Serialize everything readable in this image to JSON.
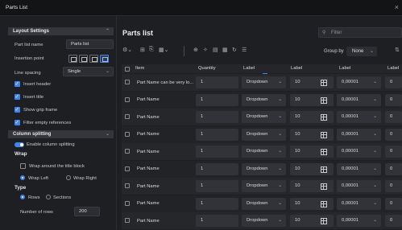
{
  "window": {
    "title": "Parts List",
    "close": "×"
  },
  "left": {
    "layout_header": "Layout Settings",
    "part_list_name_label": "Part list name",
    "part_list_name_value": "Parts list",
    "insertion_point_label": "Insertion point",
    "line_spacing_label": "Line spacing",
    "line_spacing_value": "Single",
    "checkboxes": [
      "Insert header",
      "Insert title",
      "Show grip frame",
      "Filter empty references"
    ],
    "column_header": "Column splitting",
    "enable_label": "Enable column splitting",
    "wrap_title": "Wrap",
    "wrap_around": "Wrap around the title block",
    "wrap_left": "Wrap Left",
    "wrap_right": "Wrap Right",
    "type_title": "Type",
    "rows": "Rows",
    "sections": "Sections",
    "num_rows_label": "Number of rows",
    "num_rows_value": "200"
  },
  "main": {
    "title": "Parts list",
    "filter_placeholder": "Filter",
    "group_by_label": "Group by",
    "group_by_value": "None",
    "columns": [
      "Item",
      "Quantity",
      "Label",
      "Label",
      "Label",
      "Label"
    ],
    "rows": [
      {
        "name": "Part Name can be very lo...",
        "qty": "1",
        "label": "Dropdown",
        "num": "10",
        "dec": "0,00001",
        "l4": "0"
      },
      {
        "name": "Part Name",
        "qty": "1",
        "label": "Dropdown",
        "num": "10",
        "dec": "0,00001",
        "l4": "0"
      },
      {
        "name": "Part Name",
        "qty": "1",
        "label": "Dropdown",
        "num": "10",
        "dec": "0,00001",
        "l4": "0"
      },
      {
        "name": "Part Name",
        "qty": "1",
        "label": "Dropdown",
        "num": "10",
        "dec": "0,00001",
        "l4": "0"
      },
      {
        "name": "Part Name",
        "qty": "1",
        "label": "Dropdown",
        "num": "10",
        "dec": "0,00001",
        "l4": "0"
      },
      {
        "name": "Part Name",
        "qty": "1",
        "label": "Dropdown",
        "num": "10",
        "dec": "0,00001",
        "l4": "0"
      },
      {
        "name": "Part Name",
        "qty": "1",
        "label": "Dropdown",
        "num": "10",
        "dec": "0,00001",
        "l4": "0"
      },
      {
        "name": "Part Name",
        "qty": "1",
        "label": "Dropdown",
        "num": "10",
        "dec": "0,00001",
        "l4": "0"
      },
      {
        "name": "Part Name",
        "qty": "1",
        "label": "Dropdown",
        "num": "10",
        "dec": "0,00001",
        "l4": "0"
      }
    ]
  }
}
